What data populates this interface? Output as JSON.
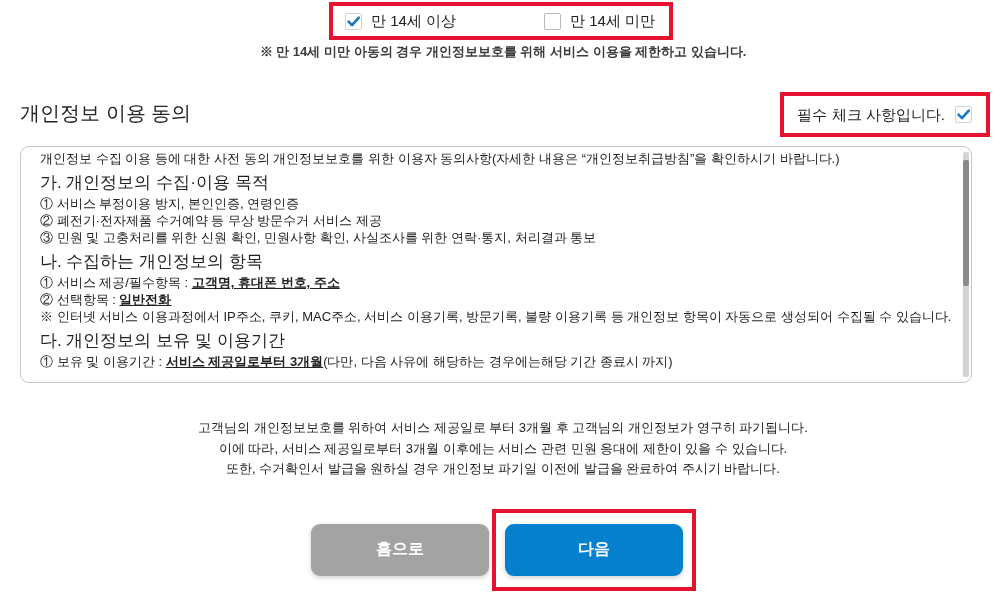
{
  "age_check": {
    "highlighted": true,
    "options": [
      {
        "label": "만 14세 이상",
        "checked": true
      },
      {
        "label": "만 14세 미만",
        "checked": false
      }
    ]
  },
  "age_notice": "※ 만 14세 미만 아동의 경우 개인정보보호를 위해 서비스 이용을 제한하고 있습니다.",
  "consent": {
    "title": "개인정보 이용 동의",
    "required": {
      "label": "필수 체크 사항입니다.",
      "checked": true,
      "highlighted": true
    },
    "terms": [
      {
        "kind": "text",
        "text": "개인정보 수집 이용 등에 대한 사전 동의 개인정보보호를 위한 이용자 동의사항(자세한 내용은 “개인정보취급방침”을 확인하시기 바랍니다.)"
      },
      {
        "kind": "heading",
        "text": "가. 개인정보의 수집·이용 목적"
      },
      {
        "kind": "text",
        "text": "① 서비스 부정이용 방지, 본인인증, 연령인증"
      },
      {
        "kind": "text",
        "text": "② 폐전기·전자제품 수거예약 등 무상 방문수거 서비스 제공"
      },
      {
        "kind": "text",
        "text": "③ 민원 및 고충처리를 위한 신원 확인, 민원사항 확인, 사실조사를 위한 연락·통지, 처리결과 통보"
      },
      {
        "kind": "heading",
        "text": "나. 수집하는 개인정보의 항목"
      },
      {
        "kind": "text",
        "text": "① 서비스 제공/필수항목 : **고객명, 휴대폰 번호, 주소**"
      },
      {
        "kind": "text",
        "text": "② 선택항목 : **일반전화**"
      },
      {
        "kind": "text",
        "text": "※ 인터넷 서비스 이용과정에서 IP주소, 쿠키, MAC주소, 서비스 이용기록, 방문기록, 불량 이용기록 등 개인정보 항목이 자동으로 생성되어 수집될 수 있습니다."
      },
      {
        "kind": "heading",
        "text": "다. 개인정보의 보유 및 이용기간"
      },
      {
        "kind": "text",
        "text": "① 보유 및 이용기간 : **서비스 제공일로부터 3개월**(다만, 다음 사유에 해당하는 경우에는해당 기간 종료시 까지)"
      }
    ]
  },
  "retention_notice": [
    "고객님의 개인정보보호를 위하여 서비스 제공일로 부터 3개월 후 고객님의 개인정보가 영구히 파기됩니다.",
    "이에 따라, 서비스 제공일로부터 3개월 이후에는 서비스 관련 민원 응대에 제한이 있을 수 있습니다.",
    "또한, 수거확인서 발급을 원하실 경우 개인정보 파기일 이전에 발급을 완료하여 주시기 바랍니다."
  ],
  "buttons": [
    {
      "label": "홈으로",
      "kind": "secondary",
      "highlighted": false
    },
    {
      "label": "다음",
      "kind": "primary",
      "highlighted": true
    }
  ]
}
